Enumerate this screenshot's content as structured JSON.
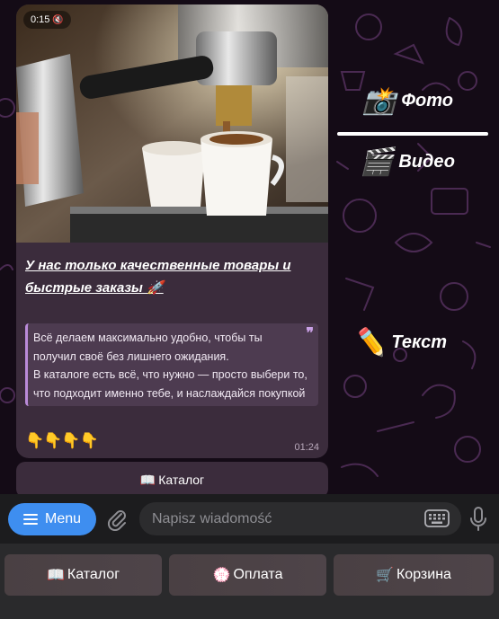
{
  "message": {
    "video_duration": "0:15",
    "headline": "У нас только качественные товары и быстрые заказы 🚀",
    "quote_lines": [
      "Всё делаем максимально удобно, чтобы ты получил своё без лишнего ожидания.",
      "В каталоге есть всё, что нужно — просто выбери то, что подходит именно тебе, и наслаждайся покупкой"
    ],
    "emojis": "👇👇👇👇",
    "time": "01:24",
    "inline_button": {
      "icon": "📖",
      "label": "Каталог"
    }
  },
  "annotations": [
    {
      "icon": "📸",
      "label": "Фото"
    },
    {
      "icon": "🎬",
      "label": "Видео"
    },
    {
      "icon": "✏️",
      "label": "Текст"
    }
  ],
  "input_bar": {
    "menu_label": "Menu",
    "placeholder": "Napisz wiadomość"
  },
  "keyboard": [
    {
      "icon": "📖",
      "label": "Каталог"
    },
    {
      "icon": "💮",
      "label": "Оплата"
    },
    {
      "icon": "🛒",
      "label": "Корзина"
    }
  ],
  "colors": {
    "background": "#140b16",
    "bubble": "#3b2c3c",
    "quote_accent": "#b98ad8",
    "menu_button": "#3e8ef0",
    "doodle": "#4a2a52"
  },
  "icons": [
    "paperclip-icon",
    "keyboard-icon",
    "microphone-icon",
    "hamburger-menu-icon",
    "mute-icon"
  ]
}
